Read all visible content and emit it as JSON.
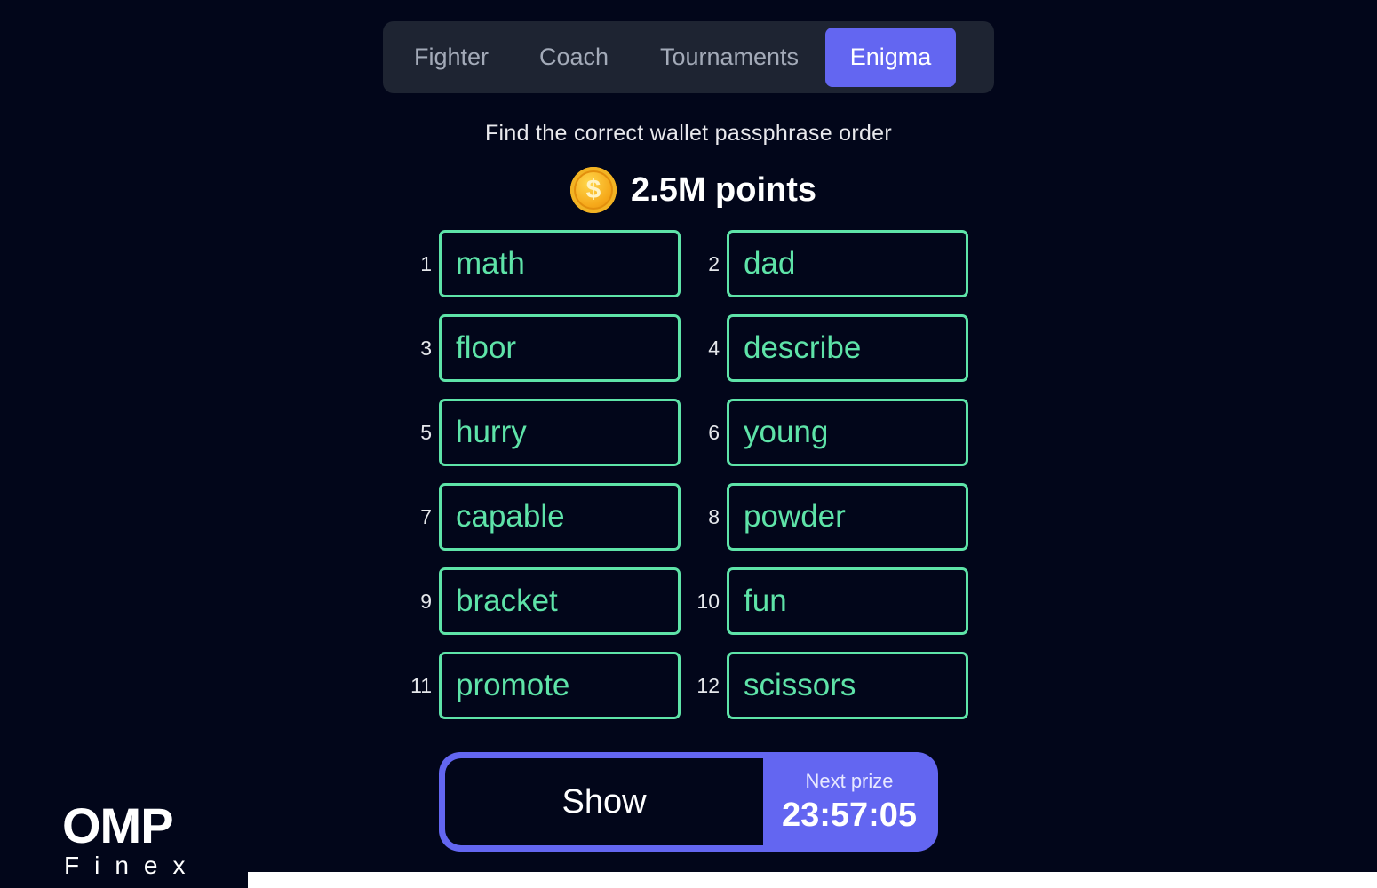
{
  "tabs": [
    {
      "label": "Fighter",
      "active": false
    },
    {
      "label": "Coach",
      "active": false
    },
    {
      "label": "Tournaments",
      "active": false
    },
    {
      "label": "Enigma",
      "active": true
    }
  ],
  "subtitle": "Find the correct wallet passphrase order",
  "points": {
    "icon": "coin-icon",
    "coin_symbol": "$",
    "label": "2.5M points"
  },
  "words": [
    {
      "num": "1",
      "word": "math"
    },
    {
      "num": "2",
      "word": "dad"
    },
    {
      "num": "3",
      "word": "floor"
    },
    {
      "num": "4",
      "word": "describe"
    },
    {
      "num": "5",
      "word": "hurry"
    },
    {
      "num": "6",
      "word": "young"
    },
    {
      "num": "7",
      "word": "capable"
    },
    {
      "num": "8",
      "word": "powder"
    },
    {
      "num": "9",
      "word": "bracket"
    },
    {
      "num": "10",
      "word": "fun"
    },
    {
      "num": "11",
      "word": "promote"
    },
    {
      "num": "12",
      "word": "scissors"
    }
  ],
  "action": {
    "show_label": "Show",
    "prize_label": "Next prize",
    "timer": "23:57:05"
  },
  "logo": {
    "main": "OMP",
    "sub": "Finex"
  },
  "colors": {
    "background": "#02061a",
    "accent": "#6366f1",
    "word_green": "#5ee3a8",
    "tab_bg": "#1e2432"
  }
}
